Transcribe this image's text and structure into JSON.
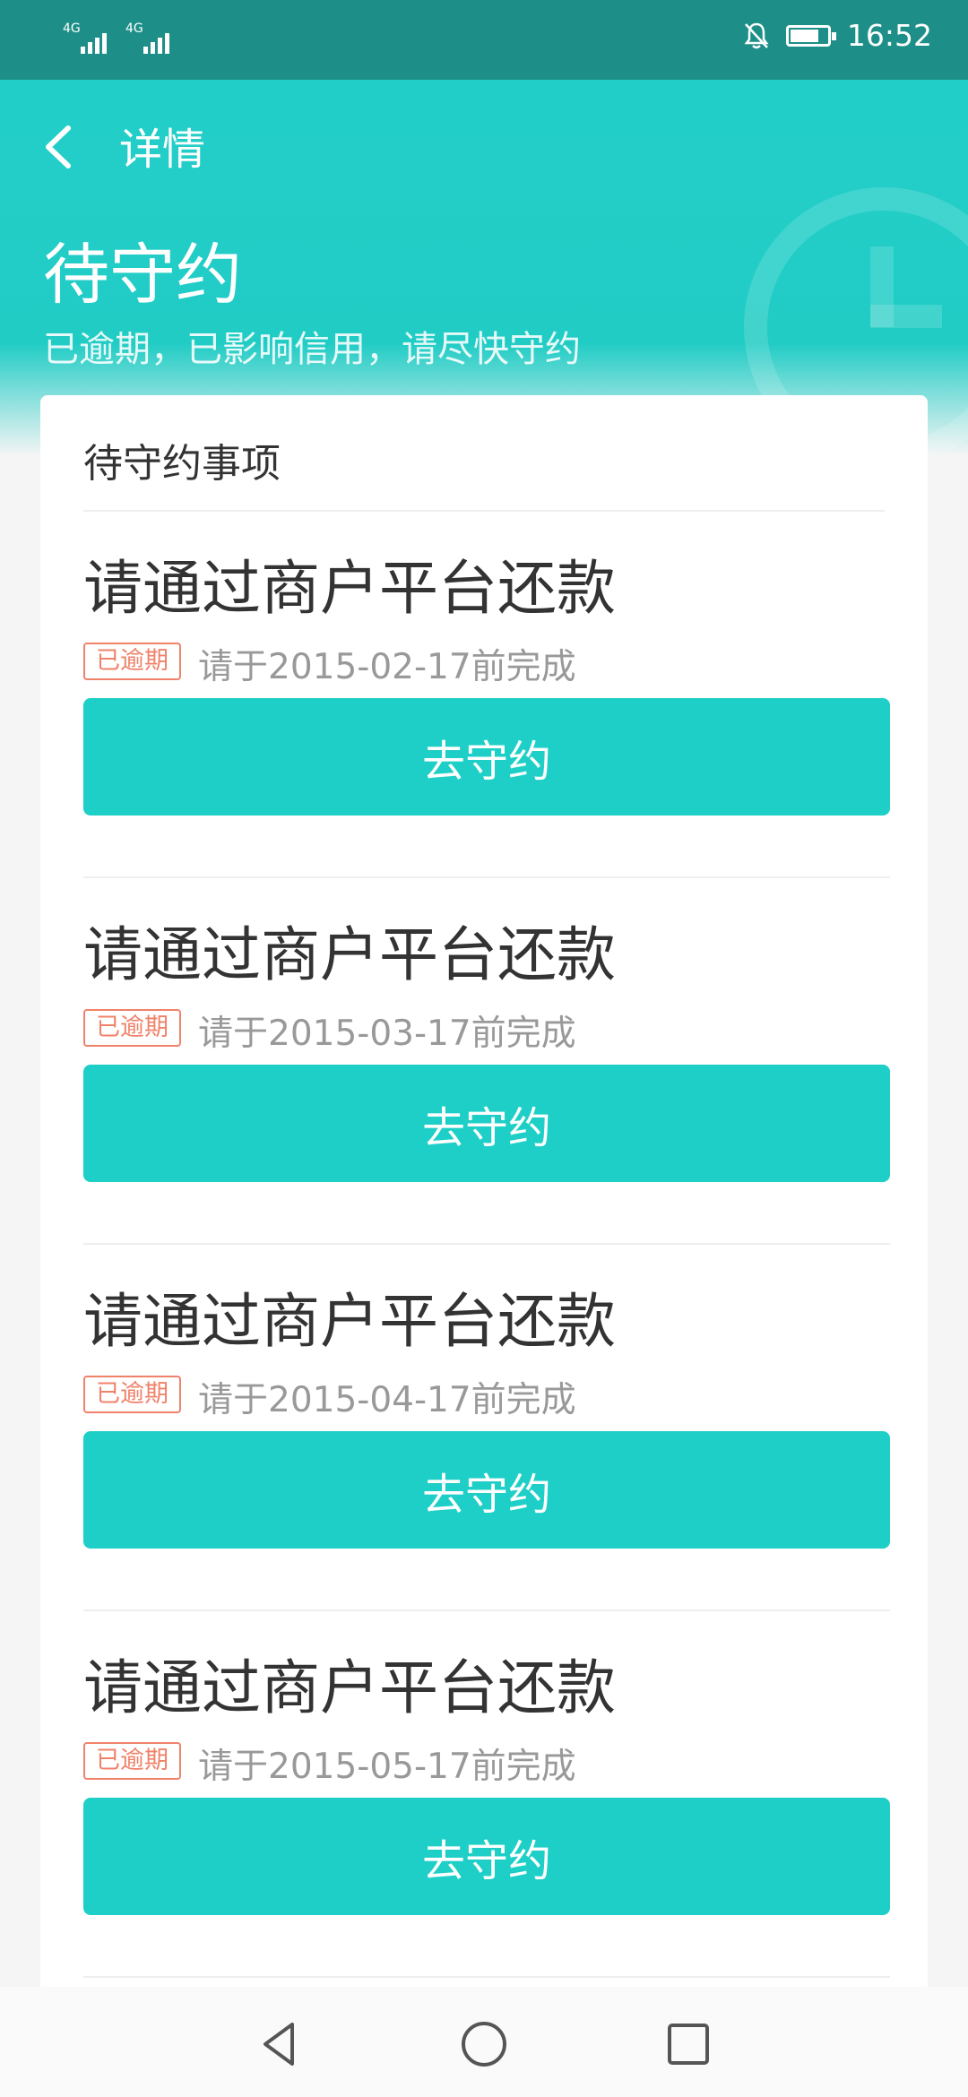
{
  "status_bar": {
    "sim1": "4G",
    "sim2": "4G",
    "time": "16:52"
  },
  "header": {
    "nav_title": "详情",
    "status_title": "待守约",
    "status_desc": "已逾期，已影响信用，请尽快守约"
  },
  "card": {
    "title": "待守约事项",
    "items": [
      {
        "title": "请通过商户平台还款",
        "badge": "已逾期",
        "due": "请于2015-02-17前完成",
        "button": "去守约"
      },
      {
        "title": "请通过商户平台还款",
        "badge": "已逾期",
        "due": "请于2015-03-17前完成",
        "button": "去守约"
      },
      {
        "title": "请通过商户平台还款",
        "badge": "已逾期",
        "due": "请于2015-04-17前完成",
        "button": "去守约"
      },
      {
        "title": "请通过商户平台还款",
        "badge": "已逾期",
        "due": "请于2015-05-17前完成",
        "button": "去守约"
      }
    ]
  },
  "icons": {
    "back": "chevron-left-icon",
    "mute": "bell-off-icon",
    "battery": "battery-charging-icon",
    "nav_back": "triangle-back-icon",
    "nav_home": "circle-home-icon",
    "nav_recent": "square-recent-icon"
  },
  "colors": {
    "primary": "#1ecfc7",
    "status_bar": "#1d8f88",
    "overdue": "#f0826a"
  }
}
